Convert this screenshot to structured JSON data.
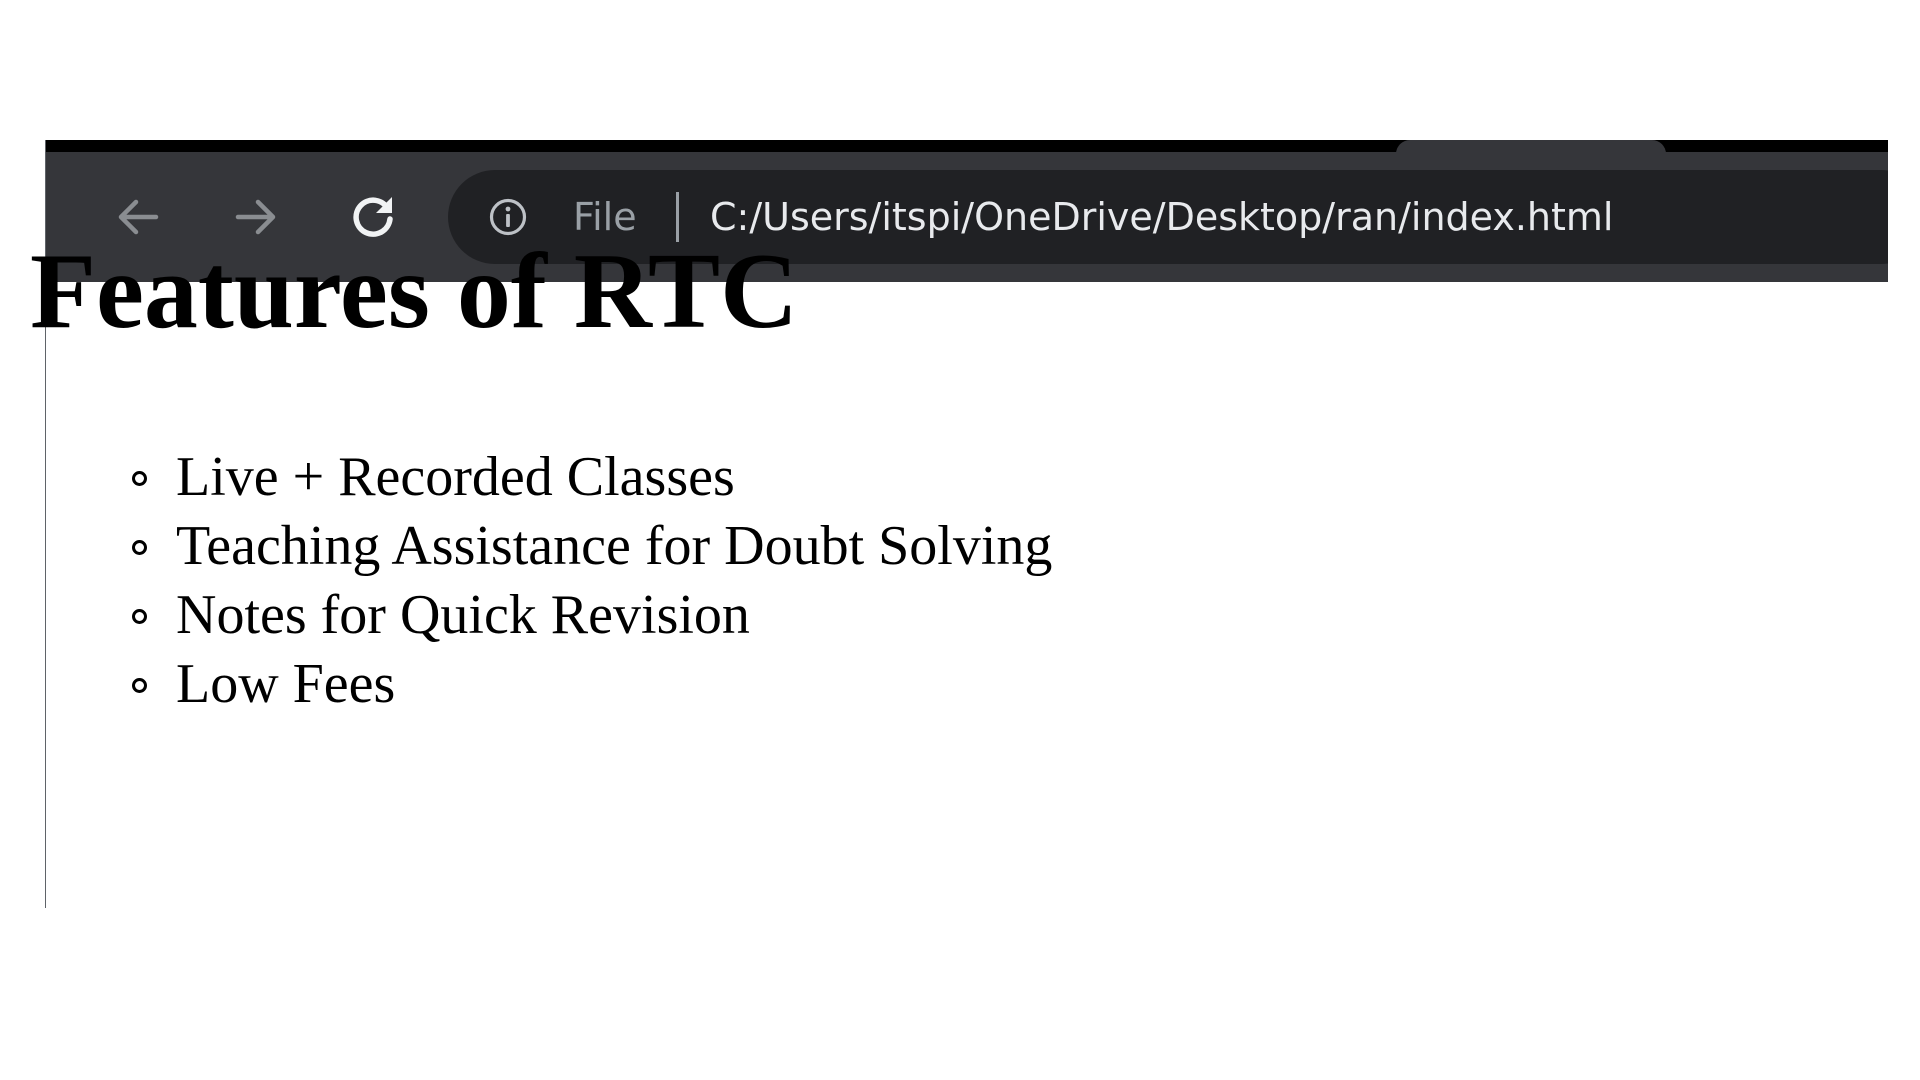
{
  "browser": {
    "toolbar": {
      "back_icon": "arrow-left-icon",
      "forward_icon": "arrow-right-icon",
      "reload_icon": "reload-icon"
    },
    "address_bar": {
      "info_icon": "info-circle-icon",
      "scheme_label": "File",
      "url": "C:/Users/itspi/OneDrive/Desktop/ran/index.html"
    },
    "colors": {
      "toolbar": "#35363a",
      "omnibox": "#202124",
      "tabstrip": "#000000",
      "url_text": "#e8eaed",
      "muted_text": "#9aa0a6"
    }
  },
  "page": {
    "heading": "Features of RTC",
    "features": [
      "Live + Recorded Classes",
      "Teaching Assistance for Doubt Solving",
      "Notes for Quick Revision",
      "Low Fees"
    ]
  }
}
